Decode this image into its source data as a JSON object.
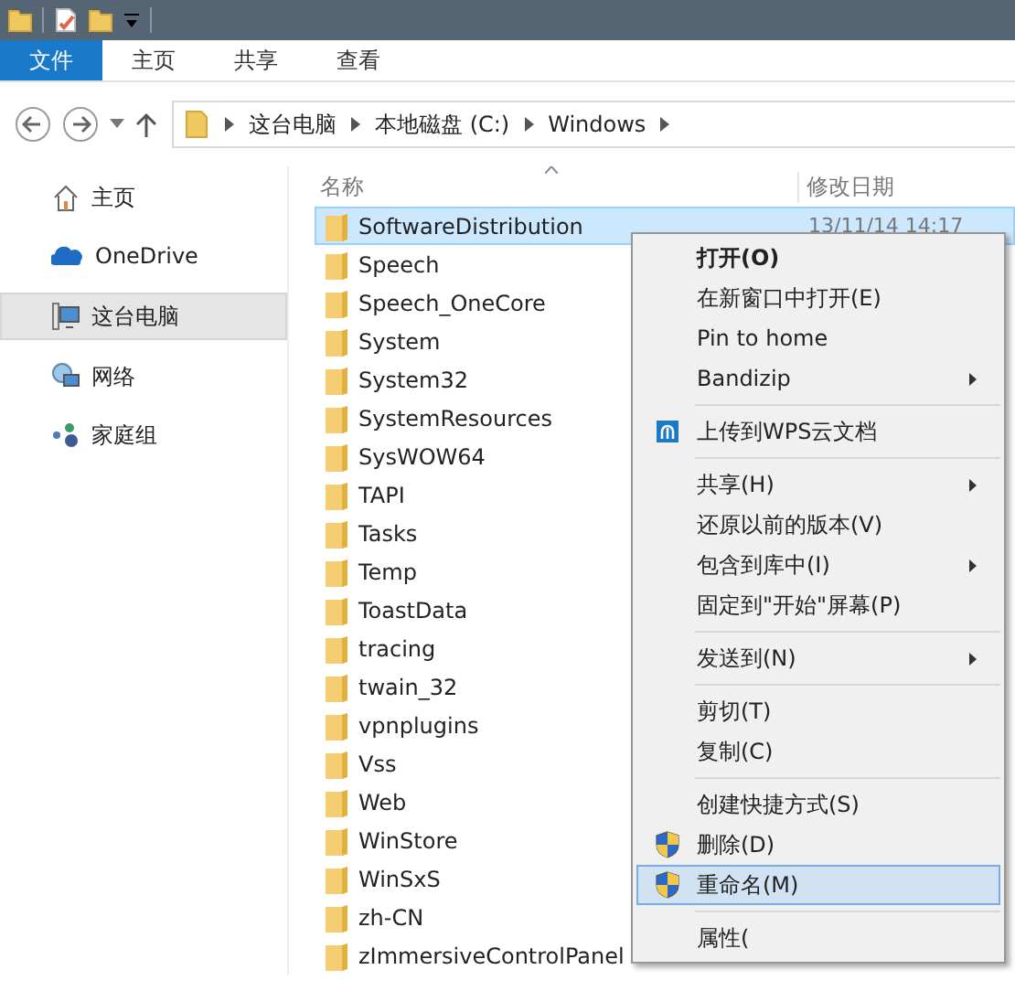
{
  "ribbon_tabs": [
    {
      "label": "文件",
      "selected": true
    },
    {
      "label": "主页",
      "selected": false
    },
    {
      "label": "共享",
      "selected": false
    },
    {
      "label": "查看",
      "selected": false
    }
  ],
  "address": {
    "crumbs": [
      "这台电脑",
      "本地磁盘 (C:)",
      "Windows"
    ]
  },
  "sidebar": {
    "items": [
      {
        "label": "主页",
        "selected": false
      },
      {
        "label": "OneDrive",
        "selected": false
      },
      {
        "label": "这台电脑",
        "selected": true
      },
      {
        "label": "网络",
        "selected": false
      },
      {
        "label": "家庭组",
        "selected": false
      }
    ]
  },
  "table": {
    "columns": [
      "名称",
      "修改日期"
    ],
    "rows": [
      {
        "name": "SoftwareDistribution",
        "date": "13/11/14 14:17",
        "selected": true
      },
      {
        "name": "Speech",
        "selected": false
      },
      {
        "name": "Speech_OneCore",
        "selected": false
      },
      {
        "name": "System",
        "selected": false
      },
      {
        "name": "System32",
        "selected": false
      },
      {
        "name": "SystemResources",
        "selected": false
      },
      {
        "name": "SysWOW64",
        "selected": false
      },
      {
        "name": "TAPI",
        "selected": false
      },
      {
        "name": "Tasks",
        "selected": false
      },
      {
        "name": "Temp",
        "selected": false
      },
      {
        "name": "ToastData",
        "selected": false
      },
      {
        "name": "tracing",
        "selected": false
      },
      {
        "name": "twain_32",
        "selected": false
      },
      {
        "name": "vpnplugins",
        "selected": false
      },
      {
        "name": "Vss",
        "selected": false
      },
      {
        "name": "Web",
        "selected": false
      },
      {
        "name": "WinStore",
        "selected": false
      },
      {
        "name": "WinSxS",
        "selected": false
      },
      {
        "name": "zh-CN",
        "selected": false
      },
      {
        "name": "zImmersiveControlPanel",
        "selected": false
      }
    ]
  },
  "context_menu": {
    "items": [
      {
        "kind": "item",
        "label": "打开(O)",
        "bold": true,
        "submenu": false,
        "selected": false
      },
      {
        "kind": "item",
        "label": "在新窗口中打开(E)",
        "bold": false,
        "submenu": false,
        "selected": false
      },
      {
        "kind": "item",
        "label": "Pin to home",
        "bold": false,
        "submenu": false,
        "selected": false
      },
      {
        "kind": "item",
        "label": "Bandizip",
        "bold": false,
        "submenu": true,
        "selected": false
      },
      {
        "kind": "separator"
      },
      {
        "kind": "upload",
        "label": "上传到WPS云文档",
        "bold": false,
        "submenu": false,
        "selected": false
      },
      {
        "kind": "separator"
      },
      {
        "kind": "item",
        "label": "共享(H)",
        "bold": false,
        "submenu": true,
        "selected": false
      },
      {
        "kind": "item",
        "label": "还原以前的版本(V)",
        "bold": false,
        "submenu": false,
        "selected": false
      },
      {
        "kind": "item",
        "label": "包含到库中(I)",
        "bold": false,
        "submenu": true,
        "selected": false
      },
      {
        "kind": "item",
        "label": "固定到\"开始\"屏幕(P)",
        "bold": false,
        "submenu": false,
        "selected": false
      },
      {
        "kind": "separator"
      },
      {
        "kind": "item",
        "label": "发送到(N)",
        "bold": false,
        "submenu": true,
        "selected": false
      },
      {
        "kind": "separator"
      },
      {
        "kind": "item",
        "label": "剪切(T)",
        "bold": false,
        "submenu": false,
        "selected": false
      },
      {
        "kind": "item",
        "label": "复制(C)",
        "bold": false,
        "submenu": false,
        "selected": false
      },
      {
        "kind": "separator"
      },
      {
        "kind": "item",
        "label": "创建快捷方式(S)",
        "bold": false,
        "submenu": false,
        "selected": false
      },
      {
        "kind": "shield",
        "label": "删除(D)",
        "bold": false,
        "submenu": false,
        "selected": false
      },
      {
        "kind": "shield",
        "label": "重命名(M)",
        "bold": false,
        "submenu": false,
        "selected": true
      },
      {
        "kind": "separator"
      },
      {
        "kind": "item",
        "label": "属性(",
        "bold": false,
        "submenu": false,
        "selected": false
      }
    ]
  }
}
